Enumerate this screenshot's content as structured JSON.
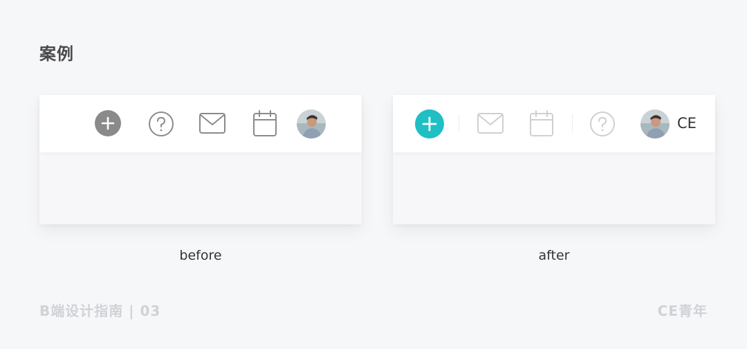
{
  "page": {
    "title": "案例",
    "footer_left": "B端设计指南 | 03",
    "footer_right": "CE青年"
  },
  "before": {
    "caption": "before",
    "icons": [
      "plus-circle-icon",
      "help-circle-icon",
      "mail-icon",
      "calendar-icon",
      "avatar"
    ],
    "icon_color": "#888888"
  },
  "after": {
    "caption": "after",
    "icons": [
      "plus-circle-icon",
      "mail-icon",
      "calendar-icon",
      "help-circle-icon",
      "avatar"
    ],
    "accent_color": "#1fbfc4",
    "muted_icon_color": "#cfcfcf",
    "user_name": "CE"
  }
}
